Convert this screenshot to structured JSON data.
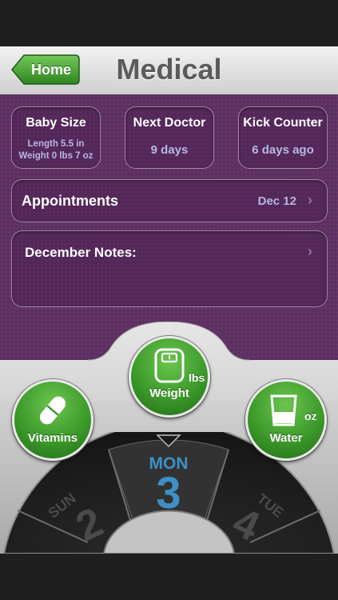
{
  "header": {
    "home_label": "Home",
    "title": "Medical"
  },
  "cards": {
    "baby_size": {
      "title": "Baby Size",
      "line1": "Length 5.5 in",
      "line2": "Weight 0 lbs 7 oz"
    },
    "next_doctor": {
      "title": "Next Doctor",
      "value": "9 days"
    },
    "kick_counter": {
      "title": "Kick Counter",
      "value": "6 days ago"
    }
  },
  "appointments": {
    "label": "Appointments",
    "date": "Dec 12"
  },
  "notes": {
    "label": "December Notes:"
  },
  "actions": {
    "weight": {
      "label": "Weight",
      "unit": "lbs"
    },
    "vitamins": {
      "label": "Vitamins"
    },
    "water": {
      "label": "Water",
      "unit": "oz"
    }
  },
  "dial": {
    "prev": {
      "day": "SUN",
      "num": "2"
    },
    "current": {
      "day": "MON",
      "num": "3"
    },
    "next": {
      "day": "TUE",
      "num": "4"
    }
  },
  "colors": {
    "accent_blue": "#3d8fc6",
    "button_green": "#3c9a2a",
    "panel_purple": "#5d2f62"
  }
}
